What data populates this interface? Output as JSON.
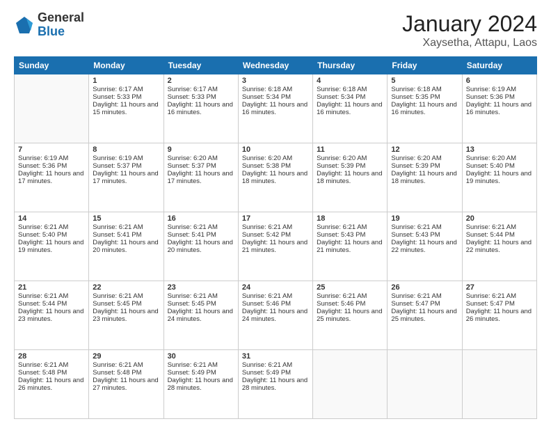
{
  "logo": {
    "general": "General",
    "blue": "Blue"
  },
  "header": {
    "month": "January 2024",
    "location": "Xaysetha, Attapu, Laos"
  },
  "days_of_week": [
    "Sunday",
    "Monday",
    "Tuesday",
    "Wednesday",
    "Thursday",
    "Friday",
    "Saturday"
  ],
  "weeks": [
    [
      {
        "day": "",
        "sunrise": "",
        "sunset": "",
        "daylight": ""
      },
      {
        "day": "1",
        "sunrise": "Sunrise: 6:17 AM",
        "sunset": "Sunset: 5:33 PM",
        "daylight": "Daylight: 11 hours and 15 minutes."
      },
      {
        "day": "2",
        "sunrise": "Sunrise: 6:17 AM",
        "sunset": "Sunset: 5:33 PM",
        "daylight": "Daylight: 11 hours and 16 minutes."
      },
      {
        "day": "3",
        "sunrise": "Sunrise: 6:18 AM",
        "sunset": "Sunset: 5:34 PM",
        "daylight": "Daylight: 11 hours and 16 minutes."
      },
      {
        "day": "4",
        "sunrise": "Sunrise: 6:18 AM",
        "sunset": "Sunset: 5:34 PM",
        "daylight": "Daylight: 11 hours and 16 minutes."
      },
      {
        "day": "5",
        "sunrise": "Sunrise: 6:18 AM",
        "sunset": "Sunset: 5:35 PM",
        "daylight": "Daylight: 11 hours and 16 minutes."
      },
      {
        "day": "6",
        "sunrise": "Sunrise: 6:19 AM",
        "sunset": "Sunset: 5:36 PM",
        "daylight": "Daylight: 11 hours and 16 minutes."
      }
    ],
    [
      {
        "day": "7",
        "sunrise": "Sunrise: 6:19 AM",
        "sunset": "Sunset: 5:36 PM",
        "daylight": "Daylight: 11 hours and 17 minutes."
      },
      {
        "day": "8",
        "sunrise": "Sunrise: 6:19 AM",
        "sunset": "Sunset: 5:37 PM",
        "daylight": "Daylight: 11 hours and 17 minutes."
      },
      {
        "day": "9",
        "sunrise": "Sunrise: 6:20 AM",
        "sunset": "Sunset: 5:37 PM",
        "daylight": "Daylight: 11 hours and 17 minutes."
      },
      {
        "day": "10",
        "sunrise": "Sunrise: 6:20 AM",
        "sunset": "Sunset: 5:38 PM",
        "daylight": "Daylight: 11 hours and 18 minutes."
      },
      {
        "day": "11",
        "sunrise": "Sunrise: 6:20 AM",
        "sunset": "Sunset: 5:39 PM",
        "daylight": "Daylight: 11 hours and 18 minutes."
      },
      {
        "day": "12",
        "sunrise": "Sunrise: 6:20 AM",
        "sunset": "Sunset: 5:39 PM",
        "daylight": "Daylight: 11 hours and 18 minutes."
      },
      {
        "day": "13",
        "sunrise": "Sunrise: 6:20 AM",
        "sunset": "Sunset: 5:40 PM",
        "daylight": "Daylight: 11 hours and 19 minutes."
      }
    ],
    [
      {
        "day": "14",
        "sunrise": "Sunrise: 6:21 AM",
        "sunset": "Sunset: 5:40 PM",
        "daylight": "Daylight: 11 hours and 19 minutes."
      },
      {
        "day": "15",
        "sunrise": "Sunrise: 6:21 AM",
        "sunset": "Sunset: 5:41 PM",
        "daylight": "Daylight: 11 hours and 20 minutes."
      },
      {
        "day": "16",
        "sunrise": "Sunrise: 6:21 AM",
        "sunset": "Sunset: 5:41 PM",
        "daylight": "Daylight: 11 hours and 20 minutes."
      },
      {
        "day": "17",
        "sunrise": "Sunrise: 6:21 AM",
        "sunset": "Sunset: 5:42 PM",
        "daylight": "Daylight: 11 hours and 21 minutes."
      },
      {
        "day": "18",
        "sunrise": "Sunrise: 6:21 AM",
        "sunset": "Sunset: 5:43 PM",
        "daylight": "Daylight: 11 hours and 21 minutes."
      },
      {
        "day": "19",
        "sunrise": "Sunrise: 6:21 AM",
        "sunset": "Sunset: 5:43 PM",
        "daylight": "Daylight: 11 hours and 22 minutes."
      },
      {
        "day": "20",
        "sunrise": "Sunrise: 6:21 AM",
        "sunset": "Sunset: 5:44 PM",
        "daylight": "Daylight: 11 hours and 22 minutes."
      }
    ],
    [
      {
        "day": "21",
        "sunrise": "Sunrise: 6:21 AM",
        "sunset": "Sunset: 5:44 PM",
        "daylight": "Daylight: 11 hours and 23 minutes."
      },
      {
        "day": "22",
        "sunrise": "Sunrise: 6:21 AM",
        "sunset": "Sunset: 5:45 PM",
        "daylight": "Daylight: 11 hours and 23 minutes."
      },
      {
        "day": "23",
        "sunrise": "Sunrise: 6:21 AM",
        "sunset": "Sunset: 5:45 PM",
        "daylight": "Daylight: 11 hours and 24 minutes."
      },
      {
        "day": "24",
        "sunrise": "Sunrise: 6:21 AM",
        "sunset": "Sunset: 5:46 PM",
        "daylight": "Daylight: 11 hours and 24 minutes."
      },
      {
        "day": "25",
        "sunrise": "Sunrise: 6:21 AM",
        "sunset": "Sunset: 5:46 PM",
        "daylight": "Daylight: 11 hours and 25 minutes."
      },
      {
        "day": "26",
        "sunrise": "Sunrise: 6:21 AM",
        "sunset": "Sunset: 5:47 PM",
        "daylight": "Daylight: 11 hours and 25 minutes."
      },
      {
        "day": "27",
        "sunrise": "Sunrise: 6:21 AM",
        "sunset": "Sunset: 5:47 PM",
        "daylight": "Daylight: 11 hours and 26 minutes."
      }
    ],
    [
      {
        "day": "28",
        "sunrise": "Sunrise: 6:21 AM",
        "sunset": "Sunset: 5:48 PM",
        "daylight": "Daylight: 11 hours and 26 minutes."
      },
      {
        "day": "29",
        "sunrise": "Sunrise: 6:21 AM",
        "sunset": "Sunset: 5:48 PM",
        "daylight": "Daylight: 11 hours and 27 minutes."
      },
      {
        "day": "30",
        "sunrise": "Sunrise: 6:21 AM",
        "sunset": "Sunset: 5:49 PM",
        "daylight": "Daylight: 11 hours and 28 minutes."
      },
      {
        "day": "31",
        "sunrise": "Sunrise: 6:21 AM",
        "sunset": "Sunset: 5:49 PM",
        "daylight": "Daylight: 11 hours and 28 minutes."
      },
      {
        "day": "",
        "sunrise": "",
        "sunset": "",
        "daylight": ""
      },
      {
        "day": "",
        "sunrise": "",
        "sunset": "",
        "daylight": ""
      },
      {
        "day": "",
        "sunrise": "",
        "sunset": "",
        "daylight": ""
      }
    ]
  ]
}
